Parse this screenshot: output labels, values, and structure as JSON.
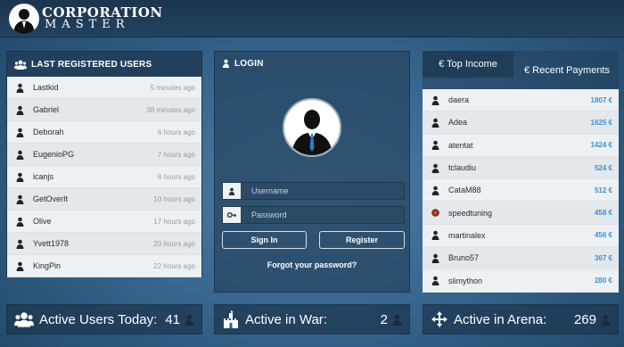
{
  "brand": {
    "line1": "CORPORATION",
    "line2": "MASTER"
  },
  "users_panel": {
    "title": "LAST REGISTERED USERS",
    "rows": [
      {
        "name": "Lastkid",
        "time": "5 minutes ago"
      },
      {
        "name": "Gabriel",
        "time": "38 minutes ago"
      },
      {
        "name": "Deborah",
        "time": "6 hours ago"
      },
      {
        "name": "EugenioPG",
        "time": "7 hours ago"
      },
      {
        "name": "icanjs",
        "time": "8 hours ago"
      },
      {
        "name": "GetOverIt",
        "time": "10 hours ago"
      },
      {
        "name": "Olive",
        "time": "17 hours ago"
      },
      {
        "name": "Yvett1978",
        "time": "20 hours ago"
      },
      {
        "name": "KingPin",
        "time": "22 hours ago"
      }
    ]
  },
  "login": {
    "title": "LOGIN",
    "username_placeholder": "Username",
    "password_placeholder": "Password",
    "signin_label": "Sign In",
    "register_label": "Register",
    "forgot_label": "Forgot your password?"
  },
  "income_panel": {
    "tab_top": "€ Top Income",
    "tab_recent": "€ Recent Payments",
    "rows": [
      {
        "name": "daera",
        "amount": "1807 €",
        "avatar": "user-icon"
      },
      {
        "name": "Adea",
        "amount": "1625 €",
        "avatar": "user-icon"
      },
      {
        "name": "atentat",
        "amount": "1424 €",
        "avatar": "user-icon"
      },
      {
        "name": "tclaudiu",
        "amount": "524 €",
        "avatar": "user-icon"
      },
      {
        "name": "CataM88",
        "amount": "512 €",
        "avatar": "user-icon"
      },
      {
        "name": "speedtuning",
        "amount": "458 €",
        "avatar": "custom-avatar"
      },
      {
        "name": "martinalex",
        "amount": "456 €",
        "avatar": "user-icon"
      },
      {
        "name": "Bruno57",
        "amount": "367 €",
        "avatar": "user-icon"
      },
      {
        "name": "slimython",
        "amount": "280 €",
        "avatar": "user-icon"
      }
    ]
  },
  "stats": {
    "today_label": "Active Users Today:",
    "today_value": "41",
    "war_label": "Active in War:",
    "war_value": "2",
    "arena_label": "Active in Arena:",
    "arena_value": "269"
  },
  "colors": {
    "amount": "#3d8fd6",
    "header": "#22405c",
    "background": "#3a6a93"
  }
}
